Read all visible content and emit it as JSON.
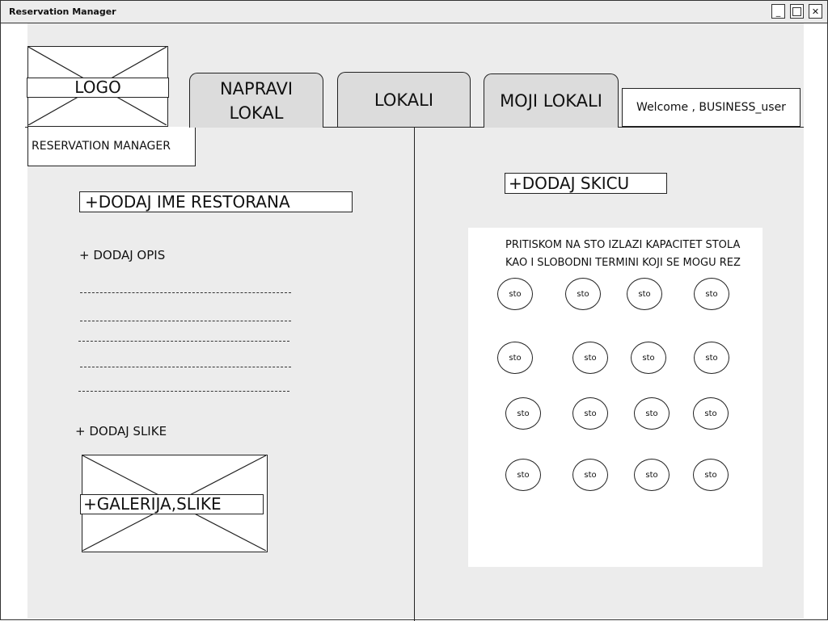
{
  "window": {
    "title": "Reservation Manager",
    "controls": {
      "minimize": "_",
      "maximize": "□",
      "close": "✕"
    }
  },
  "header": {
    "logo_label": "LOGO",
    "brand": "RESERVATION MANAGER",
    "tabs": [
      {
        "line1": "NAPRAVI",
        "line2": "LOKAL"
      },
      {
        "line1": "LOKALI",
        "line2": ""
      },
      {
        "line1": "MOJI LOKALI",
        "line2": ""
      }
    ],
    "welcome": "Welcome , BUSINESS_user"
  },
  "left": {
    "add_name": "+DODAJ IME RESTORANA",
    "add_description": "+ DODAJ OPIS",
    "add_images": "+ DODAJ SLIKE",
    "gallery_label": "+GALERIJA,SLIKE"
  },
  "right": {
    "add_sketch": "+DODAJ SKICU",
    "hint_line1": "PRITISKOM NA STO IZLAZI KAPACITET STOLA",
    "hint_line2": "KAO I SLOBODNI TERMINI KOJI SE MOGU REZ",
    "table_label": "sto",
    "table_count": 16
  },
  "icons": {
    "minimize": "minimize-icon",
    "maximize": "maximize-icon",
    "close": "close-icon",
    "logo_placeholder": "image-placeholder-icon",
    "gallery_placeholder": "image-placeholder-icon"
  }
}
